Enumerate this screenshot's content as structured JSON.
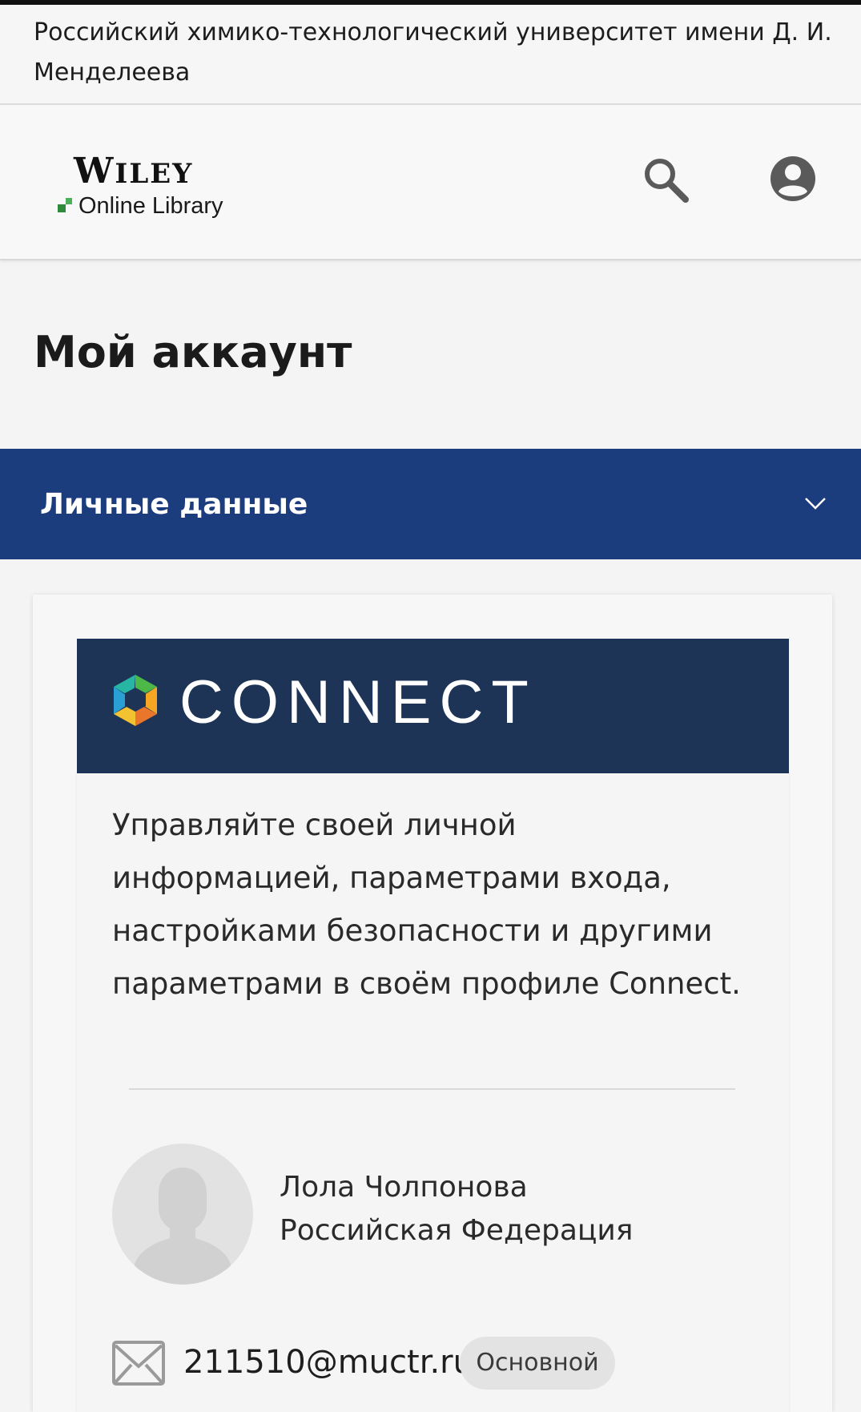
{
  "institution": {
    "name": "Российский химико-технологический университет имени Д. И. Менделеева"
  },
  "header": {
    "logo": {
      "wordmark": "Wiley",
      "subtitle": "Online Library"
    },
    "icons": {
      "search": "search-icon",
      "account": "account-circle-icon"
    }
  },
  "page": {
    "title": "Мой аккаунт"
  },
  "section": {
    "label": "Личные данные",
    "expanded": true,
    "icon": "chevron-down-icon",
    "color": "#1c3d7d"
  },
  "connect": {
    "brand": "CONNECT",
    "banner_color": "#1e3457",
    "description": "Управляйте своей личной информацией, параметрами входа, настройками безопасности и другими параметрами в своём профиле Connect.",
    "user": {
      "name": "Лола Чолпонова",
      "country": "Российская Федерация"
    },
    "email": {
      "address": "211510@muctr.ru",
      "badge": "Основной",
      "icon": "envelope-icon"
    }
  }
}
